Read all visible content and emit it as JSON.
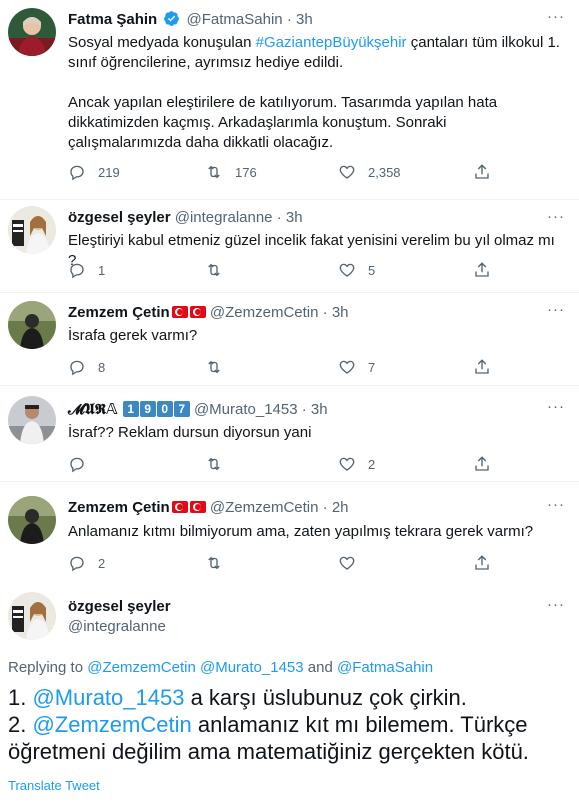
{
  "tweets": [
    {
      "name": "Fatma Şahin",
      "handle": "@FatmaSahin",
      "time": "3h",
      "text_pre": "Sosyal medyada konuşulan ",
      "hashtag": "#GaziantepBüyükşehir",
      "text_post": " çantaları tüm ilkokul 1. sınıf öğrencilerine, ayrımsız hediye edildi.\n\nAncak yapılan eleştirilere de katılıyorum. Tasarımda yapılan hata dikkatimizden kaçmış. Arkadaşlarımla konuştum. Sonraki çalışmalarımızda daha dikkatli olacağız.",
      "replies": "219",
      "retweets": "176",
      "likes": "2,358"
    },
    {
      "name": "özgesel şeyler",
      "handle": "@integralanne",
      "time": "3h",
      "text": "Eleştiriyi kabul etmeniz güzel incelik fakat yenisini verelim bu yıl olmaz mı ?",
      "replies": "1",
      "retweets": "",
      "likes": "5"
    },
    {
      "name": "Zemzem Çetin",
      "handle": "@ZemzemCetin",
      "time": "3h",
      "text": "İsrafa gerek varmı?",
      "replies": "8",
      "retweets": "",
      "likes": "7"
    },
    {
      "name": "𝓜𝖀𝕽𝔸",
      "name_digits": [
        "1",
        "9",
        "0",
        "7"
      ],
      "handle": "@Murato_1453",
      "time": "3h",
      "text": "İsraf?? Reklam dursun diyorsun yani",
      "replies": "",
      "retweets": "",
      "likes": "2"
    },
    {
      "name": "Zemzem Çetin",
      "handle": "@ZemzemCetin",
      "time": "2h",
      "text": "Anlamanız kıtmı bilmiyorum ama, zaten yapılmış tekrara gerek varmı?",
      "replies": "2",
      "retweets": "",
      "likes": ""
    }
  ],
  "main": {
    "name": "özgesel şeyler",
    "handle": "@integralanne",
    "replying_label": "Replying to ",
    "replying_mentions": [
      "@ZemzemCetin",
      "@Murato_1453",
      "@FatmaSahin"
    ],
    "and_word": " and ",
    "line1_prefix": "1. ",
    "line1_mention": "@Murato_1453",
    "line1_rest": " a karşı üslubunuz çok çirkin.",
    "line2_prefix": "2. ",
    "line2_mention": "@ZemzemCetin",
    "line2_rest": " anlamanız kıt mı bilemem. Türkçe öğretmeni değilim ama matematiğiniz gerçekten kötü.",
    "translate": "Translate Tweet"
  },
  "more_label": "···",
  "colors": {
    "accent": "#1d9bf0",
    "secondary": "#536471",
    "border": "#eff3f4"
  }
}
